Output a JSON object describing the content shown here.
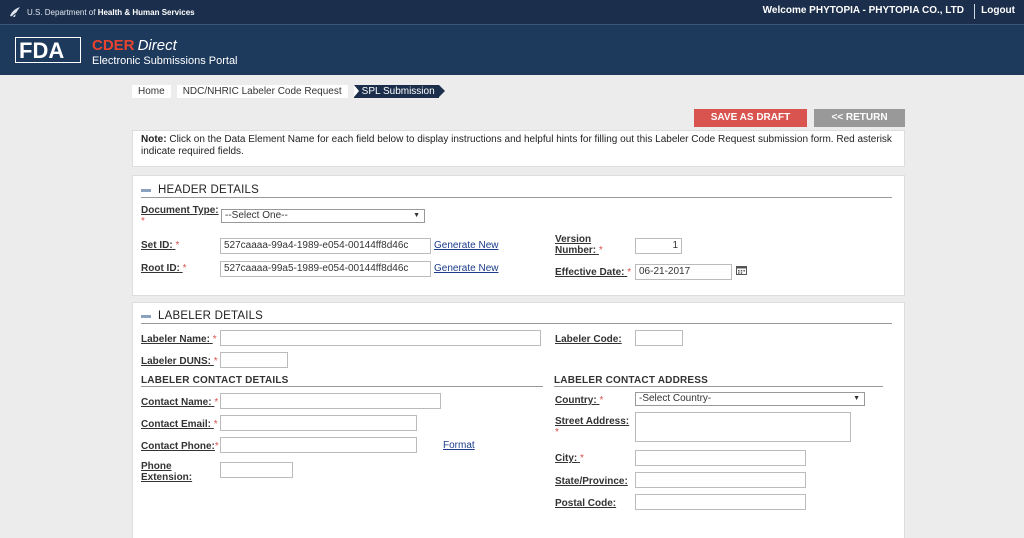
{
  "topbar": {
    "agency_prefix": "U.S. Department of ",
    "agency_bold": "Health & Human Services",
    "welcome": "Welcome PHYTOPIA - PHYTOPIA CO., LTD",
    "logout": "Logout"
  },
  "header": {
    "logo_text": "FDA",
    "title_red": "CDER",
    "title_italic": "Direct",
    "subtitle": "Electronic Submissions Portal"
  },
  "breadcrumb": [
    "Home",
    "NDC/NHRIC Labeler Code Request",
    "SPL Submission"
  ],
  "buttons": {
    "save_draft": "SAVE AS DRAFT",
    "return": "<< RETURN"
  },
  "note": {
    "bold": "Note:",
    "text": " Click on the Data Element Name for each field below to display instructions and helpful hints for filling out this Labeler Code Request submission form. Red asterisk indicate required fields."
  },
  "header_details": {
    "title": "HEADER DETAILS",
    "document_type": {
      "label": "Document Type:",
      "value": "--Select One--"
    },
    "set_id": {
      "label": "Set ID:",
      "value": "527caaaa-99a4-1989-e054-00144ff8d46c",
      "action": "Generate New"
    },
    "root_id": {
      "label": "Root ID:",
      "value": "527caaaa-99a5-1989-e054-00144ff8d46c",
      "action": "Generate New"
    },
    "version_number": {
      "label_line1": "Version",
      "label_line2": "Number:",
      "value": "1"
    },
    "effective_date": {
      "label": "Effective Date:",
      "value": "06-21-2017"
    }
  },
  "labeler_details": {
    "title": "LABELER DETAILS",
    "labeler_name": {
      "label": "Labeler Name:",
      "value": ""
    },
    "labeler_code": {
      "label": "Labeler Code:",
      "value": ""
    },
    "labeler_duns": {
      "label": "Labeler DUNS:",
      "value": ""
    },
    "contact_details_title": "LABELER CONTACT DETAILS",
    "contact_address_title": "LABELER CONTACT ADDRESS",
    "contact_name": {
      "label": "Contact Name:",
      "value": ""
    },
    "contact_email": {
      "label": "Contact Email:",
      "value": ""
    },
    "contact_phone": {
      "label": "Contact Phone:",
      "value": "",
      "action": "Format"
    },
    "phone_extension": {
      "label_line1": "Phone",
      "label_line2": "Extension:",
      "value": ""
    },
    "country": {
      "label": "Country:",
      "value": "-Select Country-"
    },
    "street_address": {
      "label": "Street Address:",
      "value": ""
    },
    "city": {
      "label": "City:",
      "value": ""
    },
    "state_province": {
      "label": "State/Province:",
      "value": ""
    },
    "postal_code": {
      "label": "Postal Code:",
      "value": ""
    }
  },
  "colors": {
    "topbar": "#1b2e4b",
    "header": "#1d3a5d",
    "accent_red": "#d9534f",
    "return_gray": "#999999",
    "link_blue": "#1b3c8a"
  },
  "icons": [
    "hhs-eagle-icon",
    "fda-logo",
    "calendar-icon",
    "chevron-down-icon"
  ]
}
